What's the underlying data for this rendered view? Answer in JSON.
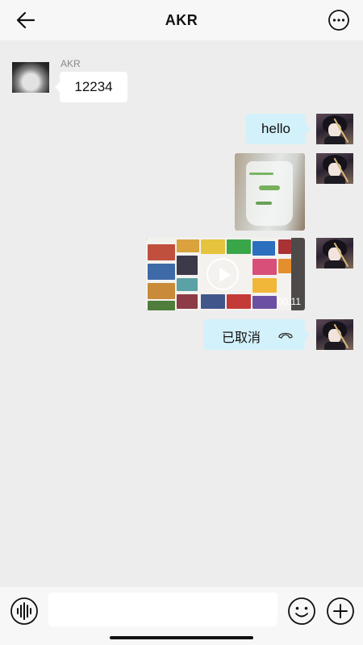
{
  "header": {
    "title": "AKR",
    "back_icon": "arrow-left-icon",
    "more_icon": "more-dots-icon"
  },
  "messages": [
    {
      "type": "text",
      "direction": "in",
      "sender": "AKR",
      "text": "12234"
    },
    {
      "type": "text",
      "direction": "out",
      "text": "hello"
    },
    {
      "type": "image",
      "direction": "out"
    },
    {
      "type": "video",
      "direction": "out",
      "duration": "00:11"
    },
    {
      "type": "call",
      "direction": "out",
      "text": "已取消",
      "icon": "hangup-icon"
    }
  ],
  "input": {
    "value": "",
    "placeholder": ""
  },
  "toolbar": {
    "voice_icon": "voice-icon",
    "emoji_icon": "emoji-icon",
    "plus_icon": "plus-icon"
  },
  "colors": {
    "background": "#ededed",
    "outgoing_bubble": "#d3f1fb",
    "incoming_bubble": "#ffffff",
    "header": "#f7f7f7"
  }
}
